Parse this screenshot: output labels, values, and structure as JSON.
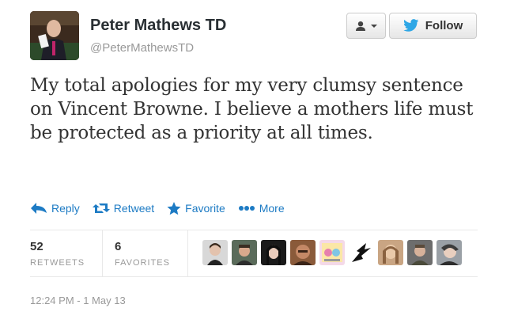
{
  "author": {
    "name": "Peter Mathews TD",
    "handle": "@PeterMathewsTD"
  },
  "header_buttons": {
    "follow_label": "Follow"
  },
  "tweet": {
    "text": "My total apologies for my very clumsy sentence on Vincent Browne. I believe a mothers life must be protected as a priority at all times."
  },
  "actions": {
    "reply": "Reply",
    "retweet": "Retweet",
    "favorite": "Favorite",
    "more": "More"
  },
  "stats": {
    "retweets_count": "52",
    "retweets_label": "RETWEETS",
    "favorites_count": "6",
    "favorites_label": "FAVORITES"
  },
  "timestamp": "12:24 PM - 1 May 13",
  "colors": {
    "link_blue": "#1d7bc4",
    "twitter_bird": "#2fa7e6"
  }
}
